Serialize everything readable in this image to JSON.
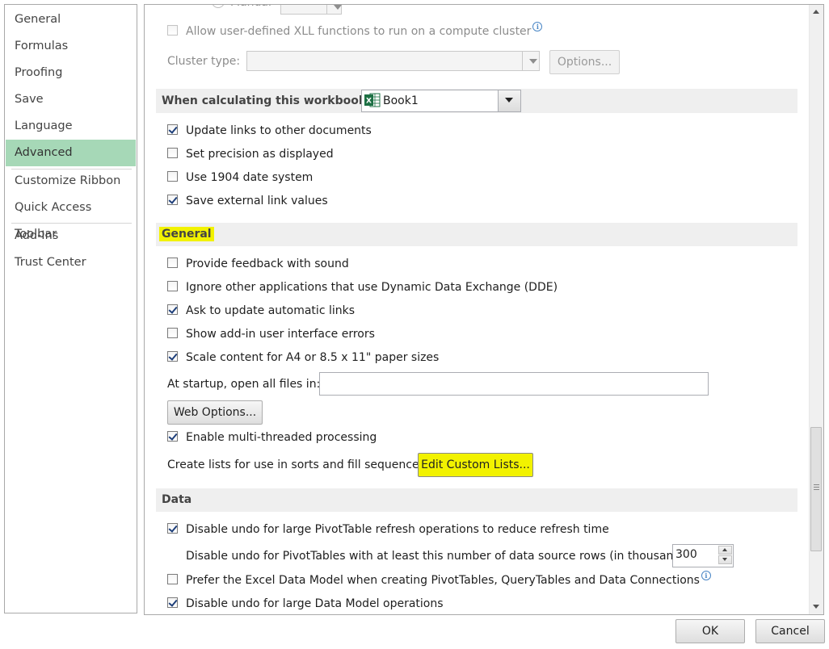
{
  "sidebar": {
    "items": [
      {
        "label": "General",
        "active": false
      },
      {
        "label": "Formulas",
        "active": false
      },
      {
        "label": "Proofing",
        "active": false
      },
      {
        "label": "Save",
        "active": false
      },
      {
        "label": "Language",
        "active": false
      },
      {
        "label": "Advanced",
        "active": true
      },
      {
        "label": "Customize Ribbon",
        "active": false
      },
      {
        "label": "Quick Access Toolbar",
        "active": false
      },
      {
        "label": "Add-Ins",
        "active": false
      },
      {
        "label": "Trust Center",
        "active": false
      }
    ]
  },
  "formulas_partial": {
    "manual_label": "Manual",
    "allow_xll_label": "Allow user-defined XLL functions to run on a compute cluster",
    "cluster_type_label": "Cluster type:",
    "cluster_type_value": "",
    "options_button": "Options..."
  },
  "workbook_section": {
    "header": "When calculating this workbook:",
    "workbook_value": "Book1",
    "options": [
      {
        "label": "Update links to other documents",
        "checked": true
      },
      {
        "label": "Set precision as displayed",
        "checked": false
      },
      {
        "label": "Use 1904 date system",
        "checked": false
      },
      {
        "label": "Save external link values",
        "checked": true
      }
    ]
  },
  "general_section": {
    "header": "General",
    "options": [
      {
        "label": "Provide feedback with sound",
        "checked": false
      },
      {
        "label": "Ignore other applications that use Dynamic Data Exchange (DDE)",
        "checked": false
      },
      {
        "label": "Ask to update automatic links",
        "checked": true
      },
      {
        "label": "Show add-in user interface errors",
        "checked": false
      },
      {
        "label": "Scale content for A4 or 8.5 x 11\" paper sizes",
        "checked": true
      }
    ],
    "startup_label": "At startup, open all files in:",
    "startup_value": "",
    "web_options_button": "Web Options...",
    "multithread_label": "Enable multi-threaded processing",
    "multithread_checked": true,
    "custom_lists_label": "Create lists for use in sorts and fill sequences:",
    "custom_lists_button": "Edit Custom Lists..."
  },
  "data_section": {
    "header": "Data",
    "disable_undo_pivot_label": "Disable undo for large PivotTable refresh operations to reduce refresh time",
    "disable_undo_pivot_checked": true,
    "rows_label": "Disable undo for PivotTables with at least this number of data source rows (in thousands):",
    "rows_value": "300",
    "prefer_model_label": "Prefer the Excel Data Model when creating PivotTables, QueryTables and Data Connections",
    "prefer_model_checked": false,
    "disable_undo_model_label": "Disable undo for large Data Model operations",
    "disable_undo_model_checked": true
  },
  "footer": {
    "ok_label": "OK",
    "cancel_label": "Cancel"
  },
  "colors": {
    "active_nav": "#a6d8b7",
    "highlight": "#f2f200",
    "section_header_bg": "#efefef",
    "excel_green": "#1d7044"
  }
}
